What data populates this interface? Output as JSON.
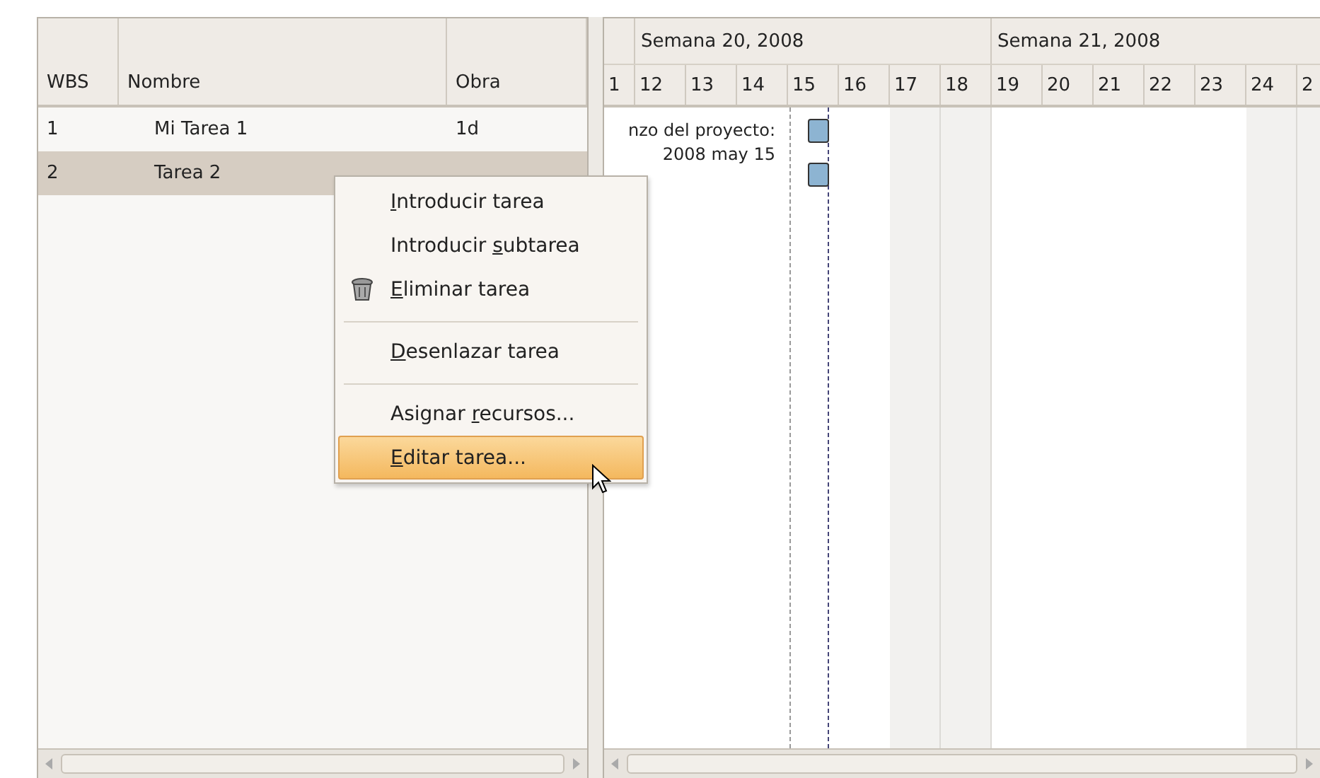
{
  "task_table": {
    "columns": [
      "WBS",
      "Nombre",
      "Obra"
    ],
    "rows": [
      {
        "wbs": "1",
        "name": "Mi Tarea 1",
        "work": "1d",
        "selected": false
      },
      {
        "wbs": "2",
        "name": "Tarea 2",
        "selected": true
      }
    ]
  },
  "gantt": {
    "weeks": [
      "Semana 20, 2008",
      "Semana 21, 2008"
    ],
    "days": [
      {
        "label": "1",
        "weekend": false
      },
      {
        "label": "12",
        "weekend": false
      },
      {
        "label": "13",
        "weekend": false
      },
      {
        "label": "14",
        "weekend": false
      },
      {
        "label": "15",
        "weekend": false
      },
      {
        "label": "16",
        "weekend": false
      },
      {
        "label": "17",
        "weekend": true
      },
      {
        "label": "18",
        "weekend": true
      },
      {
        "label": "19",
        "weekend": false
      },
      {
        "label": "20",
        "weekend": false
      },
      {
        "label": "21",
        "weekend": false
      },
      {
        "label": "22",
        "weekend": false
      },
      {
        "label": "23",
        "weekend": false
      },
      {
        "label": "24",
        "weekend": true
      },
      {
        "label": "2",
        "weekend": true
      }
    ],
    "project_start_label": [
      "nzo del proyecto:",
      "2008 may 15"
    ]
  },
  "context_menu": [
    {
      "kind": "item",
      "key": "I",
      "post": "ntroducir tarea",
      "icon": false,
      "selected": false
    },
    {
      "kind": "item",
      "pre": "Introducir ",
      "key": "s",
      "post": "ubtarea",
      "icon": false,
      "selected": false
    },
    {
      "kind": "item",
      "key": "E",
      "post": "liminar tarea",
      "icon": true,
      "selected": false
    },
    {
      "kind": "separator"
    },
    {
      "kind": "item",
      "key": "D",
      "post": "esenlazar tarea",
      "icon": false,
      "selected": false
    },
    {
      "kind": "separator"
    },
    {
      "kind": "item",
      "pre": "Asignar ",
      "key": "r",
      "post": "ecursos...",
      "icon": false,
      "selected": false
    },
    {
      "kind": "item",
      "key": "E",
      "post": "ditar tarea...",
      "icon": false,
      "selected": true
    }
  ]
}
